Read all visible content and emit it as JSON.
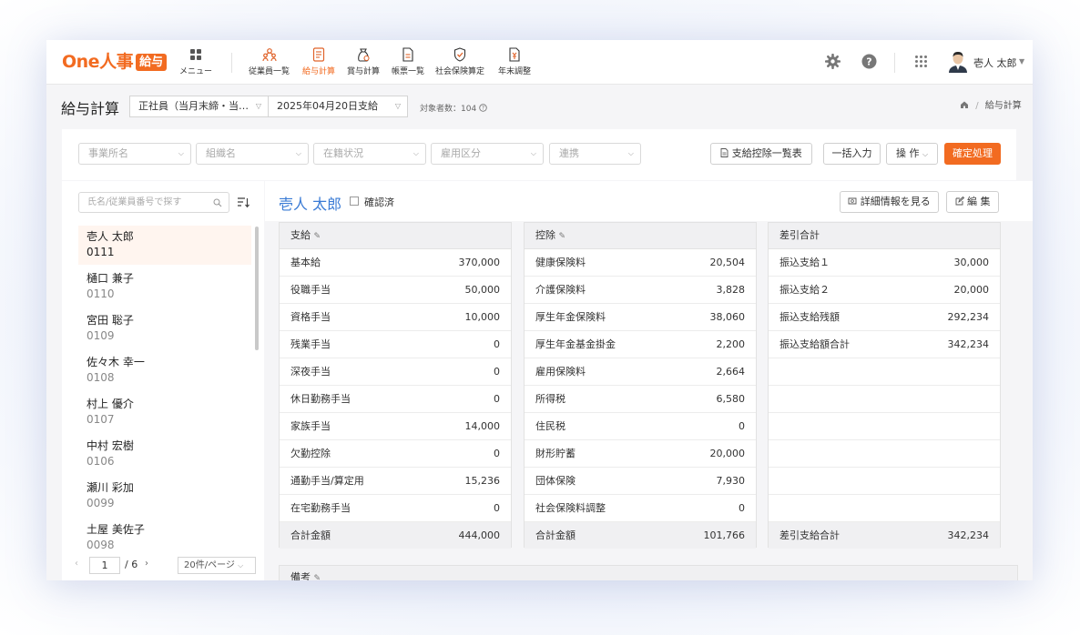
{
  "app": {
    "logo_text": "One人事",
    "logo_badge": "給与"
  },
  "nav": [
    {
      "label": "メニュー",
      "icon": "grid-icon"
    },
    {
      "label": "従業員一覧",
      "icon": "people-icon"
    },
    {
      "label": "給与計算",
      "icon": "document-icon"
    },
    {
      "label": "賞与計算",
      "icon": "bag-icon"
    },
    {
      "label": "帳票一覧",
      "icon": "file-icon"
    },
    {
      "label": "社会保険算定",
      "icon": "shield-check-icon"
    },
    {
      "label": "年末調整",
      "icon": "file-yen-icon"
    }
  ],
  "user": {
    "name": "壱人 太郎"
  },
  "header": {
    "page_title": "給与計算",
    "employment_select": "正社員（当月末締・当…",
    "pay_date_select": "2025年04月20日支給",
    "target_count": "対象者数：104",
    "breadcrumb": "給与計算"
  },
  "filters": {
    "office": "事業所名",
    "organization": "組織名",
    "status": "在籍状況",
    "employment_type": "雇用区分",
    "link": "連携"
  },
  "buttons": {
    "payroll_list": "支給控除一覧表",
    "bulk_input": "一括入力",
    "operations": "操 作",
    "confirm": "確定処理",
    "details": "詳細情報を見る",
    "edit": "編 集"
  },
  "search": {
    "placeholder": "氏名/従業員番号で探す"
  },
  "employees": [
    {
      "name": "壱人 太郎",
      "id": "0111"
    },
    {
      "name": "樋口 兼子",
      "id": "0110"
    },
    {
      "name": "宮田 聡子",
      "id": "0109"
    },
    {
      "name": "佐々木 幸一",
      "id": "0108"
    },
    {
      "name": "村上 優介",
      "id": "0107"
    },
    {
      "name": "中村 宏樹",
      "id": "0106"
    },
    {
      "name": "瀬川 彩加",
      "id": "0099"
    },
    {
      "name": "土屋 美佐子",
      "id": "0098"
    }
  ],
  "pager": {
    "page": "1",
    "total": "/ 6",
    "per_page": "20件/ページ"
  },
  "detail": {
    "employee_name": "壱人 太郎",
    "confirmed_label": "確認済",
    "payments": {
      "title": "支給",
      "rows": [
        {
          "label": "基本給",
          "value": "370,000"
        },
        {
          "label": "役職手当",
          "value": "50,000"
        },
        {
          "label": "資格手当",
          "value": "10,000"
        },
        {
          "label": "残業手当",
          "value": "0"
        },
        {
          "label": "深夜手当",
          "value": "0"
        },
        {
          "label": "休日勤務手当",
          "value": "0"
        },
        {
          "label": "家族手当",
          "value": "14,000"
        },
        {
          "label": "欠勤控除",
          "value": "0"
        },
        {
          "label": "通勤手当/算定用",
          "value": "15,236"
        },
        {
          "label": "在宅勤務手当",
          "value": "0"
        }
      ],
      "total_label": "合計金額",
      "total_value": "444,000"
    },
    "deductions": {
      "title": "控除",
      "rows": [
        {
          "label": "健康保険料",
          "value": "20,504"
        },
        {
          "label": "介護保険料",
          "value": "3,828"
        },
        {
          "label": "厚生年金保険料",
          "value": "38,060"
        },
        {
          "label": "厚生年金基金掛金",
          "value": "2,200"
        },
        {
          "label": "雇用保険料",
          "value": "2,664"
        },
        {
          "label": "所得税",
          "value": "6,580"
        },
        {
          "label": "住民税",
          "value": "0"
        },
        {
          "label": "財形貯蓄",
          "value": "20,000"
        },
        {
          "label": "団体保険",
          "value": "7,930"
        },
        {
          "label": "社会保険料調整",
          "value": "0"
        }
      ],
      "total_label": "合計金額",
      "total_value": "101,766"
    },
    "net": {
      "title": "差引合計",
      "rows": [
        {
          "label": "振込支給１",
          "value": "30,000"
        },
        {
          "label": "振込支給２",
          "value": "20,000"
        },
        {
          "label": "振込支給残額",
          "value": "292,234"
        },
        {
          "label": "振込支給額合計",
          "value": "342,234"
        },
        {
          "label": "",
          "value": ""
        },
        {
          "label": "",
          "value": ""
        },
        {
          "label": "",
          "value": ""
        },
        {
          "label": "",
          "value": ""
        },
        {
          "label": "",
          "value": ""
        },
        {
          "label": "",
          "value": ""
        }
      ],
      "total_label": "差引支給合計",
      "total_value": "342,234"
    },
    "memo_title": "備考"
  }
}
